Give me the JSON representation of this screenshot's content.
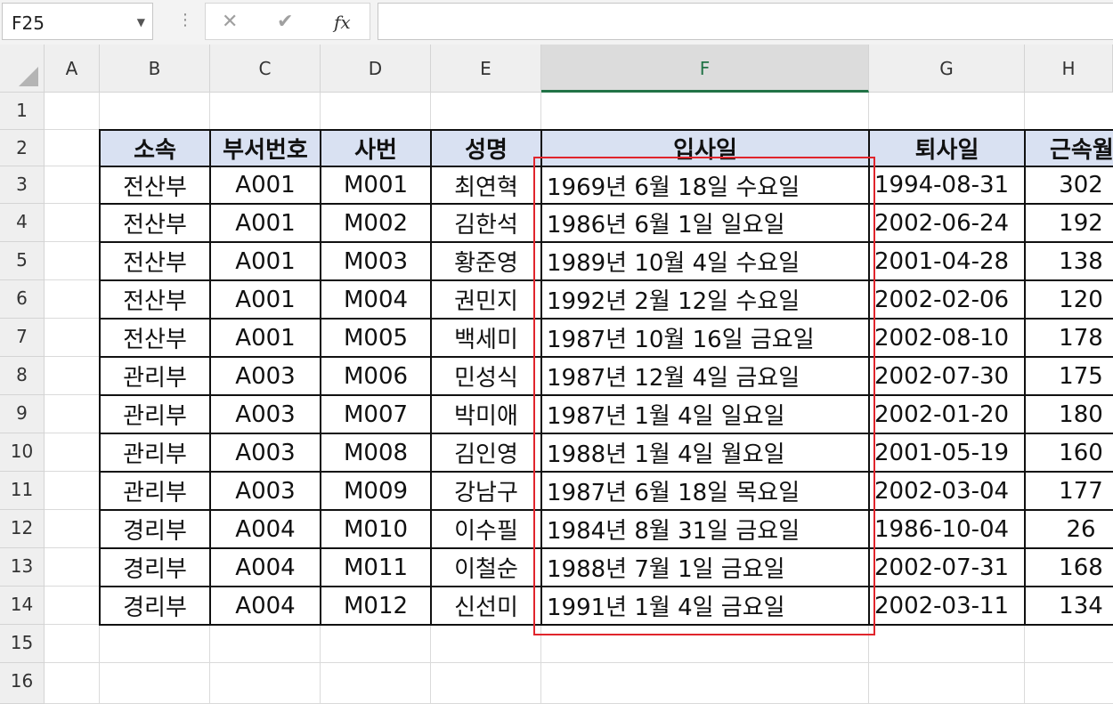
{
  "formula_bar": {
    "name_box": "F25",
    "cancel_icon": "✕",
    "enter_icon": "✔",
    "fx_label": "fx",
    "formula": ""
  },
  "columns": [
    "A",
    "B",
    "C",
    "D",
    "E",
    "F",
    "G",
    "H"
  ],
  "selected_column": "F",
  "rows": [
    "1",
    "2",
    "3",
    "4",
    "5",
    "6",
    "7",
    "8",
    "9",
    "10",
    "11",
    "12",
    "13",
    "14",
    "15",
    "16"
  ],
  "table": {
    "headers": [
      "소속",
      "부서번호",
      "사번",
      "성명",
      "입사일",
      "퇴사일",
      "근속월"
    ],
    "records": [
      [
        "전산부",
        "A001",
        "M001",
        "최연혁",
        "1969년 6월 18일 수요일",
        "1994-08-31",
        "302"
      ],
      [
        "전산부",
        "A001",
        "M002",
        "김한석",
        "1986년 6월 1일 일요일",
        "2002-06-24",
        "192"
      ],
      [
        "전산부",
        "A001",
        "M003",
        "황준영",
        "1989년 10월 4일 수요일",
        "2001-04-28",
        "138"
      ],
      [
        "전산부",
        "A001",
        "M004",
        "권민지",
        "1992년 2월 12일 수요일",
        "2002-02-06",
        "120"
      ],
      [
        "전산부",
        "A001",
        "M005",
        "백세미",
        "1987년 10월 16일 금요일",
        "2002-08-10",
        "178"
      ],
      [
        "관리부",
        "A003",
        "M006",
        "민성식",
        "1987년 12월 4일 금요일",
        "2002-07-30",
        "175"
      ],
      [
        "관리부",
        "A003",
        "M007",
        "박미애",
        "1987년 1월 4일 일요일",
        "2002-01-20",
        "180"
      ],
      [
        "관리부",
        "A003",
        "M008",
        "김인영",
        "1988년 1월 4일 월요일",
        "2001-05-19",
        "160"
      ],
      [
        "관리부",
        "A003",
        "M009",
        "강남구",
        "1987년 6월 18일 목요일",
        "2002-03-04",
        "177"
      ],
      [
        "경리부",
        "A004",
        "M010",
        "이수필",
        "1984년 8월 31일 금요일",
        "1986-10-04",
        "26"
      ],
      [
        "경리부",
        "A004",
        "M011",
        "이철순",
        "1988년 7월 1일 금요일",
        "2002-07-31",
        "168"
      ],
      [
        "경리부",
        "A004",
        "M012",
        "신선미",
        "1991년 1월 4일 금요일",
        "2002-03-11",
        "134"
      ]
    ]
  },
  "colors": {
    "header_fill": "#d9e1f2",
    "highlight_border": "#e0252c",
    "selected_col_accent": "#217346"
  }
}
